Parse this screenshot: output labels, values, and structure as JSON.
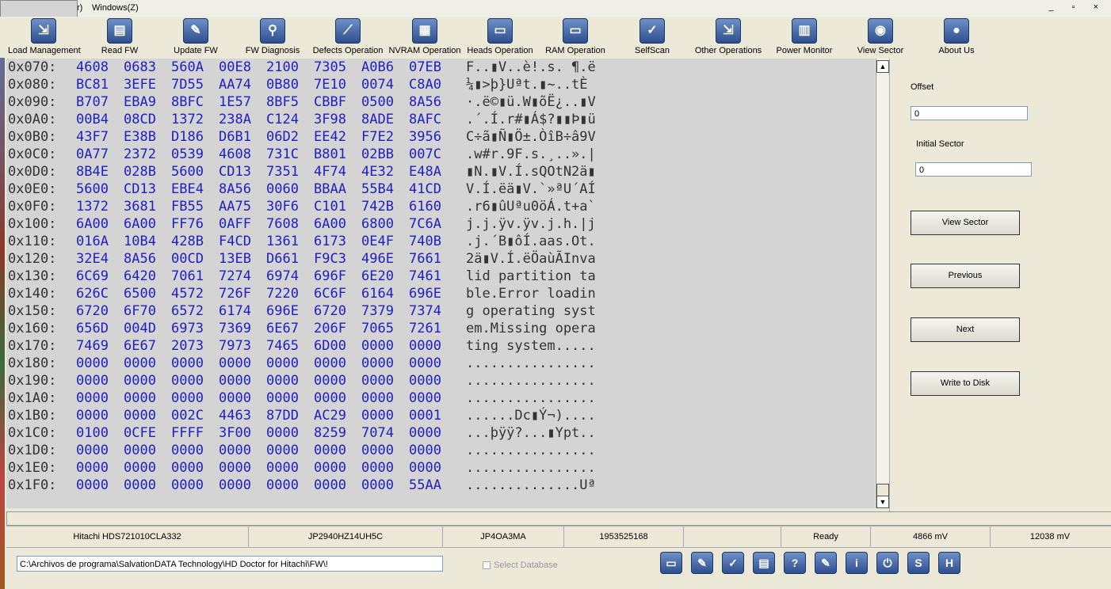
{
  "menu": {
    "partial_item": "r)",
    "windows": "Windows(Z)",
    "window_buttons": "_ ▫ ×"
  },
  "toolbar": [
    {
      "label": "Load Management",
      "icon": "load-management-icon",
      "glyph": "⇲"
    },
    {
      "label": "Read FW",
      "icon": "read-fw-icon",
      "glyph": "▤"
    },
    {
      "label": "Update FW",
      "icon": "update-fw-icon",
      "glyph": "✎"
    },
    {
      "label": "FW Diagnosis",
      "icon": "fw-diagnosis-icon",
      "glyph": "⚲"
    },
    {
      "label": "Defects Operation",
      "icon": "defects-operation-icon",
      "glyph": "⟋"
    },
    {
      "label": "NVRAM Operation",
      "icon": "nvram-operation-icon",
      "glyph": "▦"
    },
    {
      "label": "Heads Operation",
      "icon": "heads-operation-icon",
      "glyph": "▭"
    },
    {
      "label": "RAM Operation",
      "icon": "ram-operation-icon",
      "glyph": "▭"
    },
    {
      "label": "SelfScan",
      "icon": "selfscan-icon",
      "glyph": "✓"
    },
    {
      "label": "Other Operations",
      "icon": "other-operations-icon",
      "glyph": "⇲"
    },
    {
      "label": "Power Monitor",
      "icon": "power-monitor-icon",
      "glyph": "▥"
    },
    {
      "label": "View Sector",
      "icon": "view-sector-icon",
      "glyph": "◉"
    },
    {
      "label": "About Us",
      "icon": "about-us-icon",
      "glyph": "●"
    }
  ],
  "hex": [
    {
      "addr": "0x070:",
      "words": [
        "4608",
        "0683",
        "560A",
        "00E8",
        "2100",
        "7305",
        "A0B6",
        "07EB"
      ],
      "ascii": "F..▮V..è!.s. ¶.ë"
    },
    {
      "addr": "0x080:",
      "words": [
        "BC81",
        "3EFE",
        "7D55",
        "AA74",
        "0B80",
        "7E10",
        "0074",
        "C8A0"
      ],
      "ascii": "¼▮>þ}Uªt.▮~..tÈ "
    },
    {
      "addr": "0x090:",
      "words": [
        "B707",
        "EBA9",
        "8BFC",
        "1E57",
        "8BF5",
        "CBBF",
        "0500",
        "8A56"
      ],
      "ascii": "·.ë©▮ü.W▮õË¿..▮V"
    },
    {
      "addr": "0x0A0:",
      "words": [
        "00B4",
        "08CD",
        "1372",
        "238A",
        "C124",
        "3F98",
        "8ADE",
        "8AFC"
      ],
      "ascii": ".´.Í.r#▮Á$?▮▮Þ▮ü"
    },
    {
      "addr": "0x0B0:",
      "words": [
        "43F7",
        "E38B",
        "D186",
        "D6B1",
        "06D2",
        "EE42",
        "F7E2",
        "3956"
      ],
      "ascii": "C÷ã▮Ñ▮Ö±.ÒîB÷â9V"
    },
    {
      "addr": "0x0C0:",
      "words": [
        "0A77",
        "2372",
        "0539",
        "4608",
        "731C",
        "B801",
        "02BB",
        "007C"
      ],
      "ascii": ".w#r.9F.s.¸..».|"
    },
    {
      "addr": "0x0D0:",
      "words": [
        "8B4E",
        "028B",
        "5600",
        "CD13",
        "7351",
        "4F74",
        "4E32",
        "E48A"
      ],
      "ascii": "▮N.▮V.Í.sQOtN2ä▮"
    },
    {
      "addr": "0x0E0:",
      "words": [
        "5600",
        "CD13",
        "EBE4",
        "8A56",
        "0060",
        "BBAA",
        "55B4",
        "41CD"
      ],
      "ascii": "V.Í.ëä▮V.`»ªU´AÍ"
    },
    {
      "addr": "0x0F0:",
      "words": [
        "1372",
        "3681",
        "FB55",
        "AA75",
        "30F6",
        "C101",
        "742B",
        "6160"
      ],
      "ascii": ".r6▮ûUªu0öÁ.t+a`"
    },
    {
      "addr": "0x100:",
      "words": [
        "6A00",
        "6A00",
        "FF76",
        "0AFF",
        "7608",
        "6A00",
        "6800",
        "7C6A"
      ],
      "ascii": "j.j.ÿv.ÿv.j.h.|j"
    },
    {
      "addr": "0x110:",
      "words": [
        "016A",
        "10B4",
        "428B",
        "F4CD",
        "1361",
        "6173",
        "0E4F",
        "740B"
      ],
      "ascii": ".j.´B▮ôÍ.aas.Ot."
    },
    {
      "addr": "0x120:",
      "words": [
        "32E4",
        "8A56",
        "00CD",
        "13EB",
        "D661",
        "F9C3",
        "496E",
        "7661"
      ],
      "ascii": "2ä▮V.Í.ëÖaùÃInva"
    },
    {
      "addr": "0x130:",
      "words": [
        "6C69",
        "6420",
        "7061",
        "7274",
        "6974",
        "696F",
        "6E20",
        "7461"
      ],
      "ascii": "lid partition ta"
    },
    {
      "addr": "0x140:",
      "words": [
        "626C",
        "6500",
        "4572",
        "726F",
        "7220",
        "6C6F",
        "6164",
        "696E"
      ],
      "ascii": "ble.Error loadin"
    },
    {
      "addr": "0x150:",
      "words": [
        "6720",
        "6F70",
        "6572",
        "6174",
        "696E",
        "6720",
        "7379",
        "7374"
      ],
      "ascii": "g operating syst"
    },
    {
      "addr": "0x160:",
      "words": [
        "656D",
        "004D",
        "6973",
        "7369",
        "6E67",
        "206F",
        "7065",
        "7261"
      ],
      "ascii": "em.Missing opera"
    },
    {
      "addr": "0x170:",
      "words": [
        "7469",
        "6E67",
        "2073",
        "7973",
        "7465",
        "6D00",
        "0000",
        "0000"
      ],
      "ascii": "ting system....."
    },
    {
      "addr": "0x180:",
      "words": [
        "0000",
        "0000",
        "0000",
        "0000",
        "0000",
        "0000",
        "0000",
        "0000"
      ],
      "ascii": "................"
    },
    {
      "addr": "0x190:",
      "words": [
        "0000",
        "0000",
        "0000",
        "0000",
        "0000",
        "0000",
        "0000",
        "0000"
      ],
      "ascii": "................"
    },
    {
      "addr": "0x1A0:",
      "words": [
        "0000",
        "0000",
        "0000",
        "0000",
        "0000",
        "0000",
        "0000",
        "0000"
      ],
      "ascii": "................"
    },
    {
      "addr": "0x1B0:",
      "words": [
        "0000",
        "0000",
        "002C",
        "4463",
        "87DD",
        "AC29",
        "0000",
        "0001"
      ],
      "ascii": "......Dc▮Ý¬)...."
    },
    {
      "addr": "0x1C0:",
      "words": [
        "0100",
        "0CFE",
        "FFFF",
        "3F00",
        "0000",
        "8259",
        "7074",
        "0000"
      ],
      "ascii": "...þÿÿ?...▮Ypt.."
    },
    {
      "addr": "0x1D0:",
      "words": [
        "0000",
        "0000",
        "0000",
        "0000",
        "0000",
        "0000",
        "0000",
        "0000"
      ],
      "ascii": "................"
    },
    {
      "addr": "0x1E0:",
      "words": [
        "0000",
        "0000",
        "0000",
        "0000",
        "0000",
        "0000",
        "0000",
        "0000"
      ],
      "ascii": "................"
    },
    {
      "addr": "0x1F0:",
      "words": [
        "0000",
        "0000",
        "0000",
        "0000",
        "0000",
        "0000",
        "0000",
        "55AA"
      ],
      "ascii": "..............Uª"
    }
  ],
  "right": {
    "offset_label": "Offset",
    "offset_value": "0",
    "initial_sector_label": "Initial Sector",
    "initial_sector_value": "0",
    "view_sector": "View Sector",
    "previous": "Previous",
    "next": "Next",
    "write_to_disk": "Write to Disk"
  },
  "status": [
    "Hitachi HDS721010CLA332",
    "JP2940HZ14UH5C",
    "JP4OA3MA",
    "1953525168",
    "",
    "Ready",
    "4866 mV",
    "12038 mV"
  ],
  "bottom": {
    "path": "C:\\Archivos de programa\\SalvationDATA Technology\\HD Doctor for Hitachi\\FW\\!",
    "select_database": "Select Database"
  },
  "bottom_icons": [
    {
      "name": "open-folder-icon",
      "glyph": "▭"
    },
    {
      "name": "edit-document-icon",
      "glyph": "✎"
    },
    {
      "name": "check-icon",
      "glyph": "✓"
    },
    {
      "name": "save-icon",
      "glyph": "▤"
    },
    {
      "name": "help-icon",
      "glyph": "?"
    },
    {
      "name": "document-icon",
      "glyph": "✎"
    },
    {
      "name": "info-icon",
      "glyph": "i"
    },
    {
      "name": "power-icon",
      "glyph": "⏻"
    },
    {
      "name": "s-icon",
      "glyph": "S"
    },
    {
      "name": "h-icon",
      "glyph": "H"
    }
  ]
}
